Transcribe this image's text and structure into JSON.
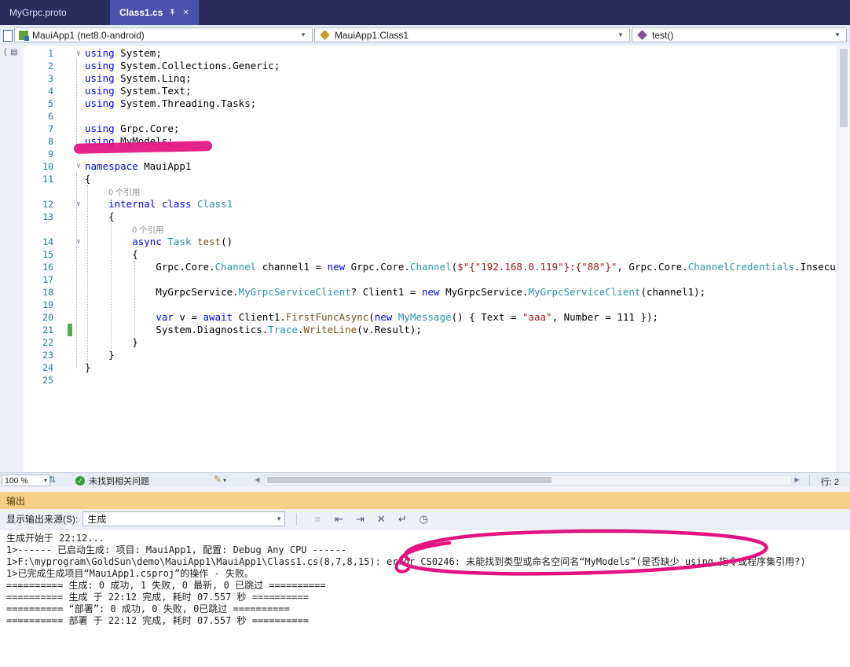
{
  "tabs": [
    {
      "label": "MyGrpc.proto",
      "active": false
    },
    {
      "label": "Class1.cs",
      "active": true
    }
  ],
  "navbar": {
    "project": "MauiApp1 (net8.0-android)",
    "type_name": "MauiApp1.Class1",
    "member": "test()"
  },
  "editor": {
    "rows": [
      {
        "num": "1",
        "fold": true,
        "segs": [
          [
            "k",
            "using"
          ],
          [
            "d",
            " System;"
          ]
        ]
      },
      {
        "num": "2",
        "segs": [
          [
            "k",
            "using"
          ],
          [
            "d",
            " System.Collections.Generic;"
          ]
        ]
      },
      {
        "num": "3",
        "segs": [
          [
            "k",
            "using"
          ],
          [
            "d",
            " System.Linq;"
          ]
        ]
      },
      {
        "num": "4",
        "segs": [
          [
            "k",
            "using"
          ],
          [
            "d",
            " System.Text;"
          ]
        ]
      },
      {
        "num": "5",
        "segs": [
          [
            "k",
            "using"
          ],
          [
            "d",
            " System.Threading.Tasks;"
          ]
        ]
      },
      {
        "num": "6",
        "segs": []
      },
      {
        "num": "7",
        "segs": [
          [
            "k",
            "using"
          ],
          [
            "d",
            " Grpc.Core;"
          ]
        ]
      },
      {
        "num": "8",
        "segs": [
          [
            "k",
            "using"
          ],
          [
            "d",
            " MyModels;"
          ]
        ]
      },
      {
        "num": "9",
        "segs": []
      },
      {
        "num": "10",
        "fold": true,
        "segs": [
          [
            "k",
            "namespace"
          ],
          [
            "d",
            " MauiApp1"
          ]
        ]
      },
      {
        "num": "11",
        "segs": [
          [
            "d",
            "{"
          ]
        ]
      },
      {
        "segs": [
          [
            "d",
            "    "
          ],
          [
            "g",
            "0 个引用"
          ]
        ]
      },
      {
        "num": "12",
        "fold": true,
        "segs": [
          [
            "d",
            "    "
          ],
          [
            "k",
            "internal"
          ],
          [
            "d",
            " "
          ],
          [
            "k",
            "class"
          ],
          [
            "d",
            " "
          ],
          [
            "t",
            "Class1"
          ]
        ]
      },
      {
        "num": "13",
        "segs": [
          [
            "d",
            "    {"
          ]
        ]
      },
      {
        "segs": [
          [
            "d",
            "        "
          ],
          [
            "g",
            "0 个引用"
          ]
        ]
      },
      {
        "num": "14",
        "fold": true,
        "segs": [
          [
            "d",
            "        "
          ],
          [
            "k",
            "async"
          ],
          [
            "d",
            " "
          ],
          [
            "t",
            "Task"
          ],
          [
            "d",
            " "
          ],
          [
            "m",
            "test"
          ],
          [
            "d",
            "()"
          ]
        ]
      },
      {
        "num": "15",
        "segs": [
          [
            "d",
            "        {"
          ]
        ]
      },
      {
        "num": "16",
        "segs": [
          [
            "d",
            "            Grpc.Core."
          ],
          [
            "t",
            "Channel"
          ],
          [
            "d",
            " channel1 = "
          ],
          [
            "k",
            "new"
          ],
          [
            "d",
            " Grpc.Core."
          ],
          [
            "t",
            "Channel"
          ],
          [
            "d",
            "("
          ],
          [
            "s",
            "$\"{\"192.168.0.119\"}:{\"88\"}\""
          ],
          [
            "d",
            ", Grpc.Core."
          ],
          [
            "t",
            "ChannelCredentials"
          ],
          [
            "d",
            ".Insecure);"
          ]
        ]
      },
      {
        "num": "17",
        "segs": []
      },
      {
        "num": "18",
        "segs": [
          [
            "d",
            "            MyGrpcService."
          ],
          [
            "t",
            "MyGrpcServiceClient"
          ],
          [
            "d",
            "? Client1 = "
          ],
          [
            "k",
            "new"
          ],
          [
            "d",
            " MyGrpcService."
          ],
          [
            "t",
            "MyGrpcServiceClient"
          ],
          [
            "d",
            "(channel1);"
          ]
        ]
      },
      {
        "num": "19",
        "segs": []
      },
      {
        "num": "20",
        "segs": [
          [
            "d",
            "            "
          ],
          [
            "k",
            "var"
          ],
          [
            "d",
            " v = "
          ],
          [
            "k",
            "await"
          ],
          [
            "d",
            " Client1."
          ],
          [
            "m",
            "FirstFuncAsync"
          ],
          [
            "d",
            "("
          ],
          [
            "k",
            "new"
          ],
          [
            "d",
            " "
          ],
          [
            "t",
            "MyMessage"
          ],
          [
            "d",
            "() { Text = "
          ],
          [
            "s",
            "\"aaa\""
          ],
          [
            "d",
            ", Number = 111 });"
          ]
        ]
      },
      {
        "num": "21",
        "chg": true,
        "segs": [
          [
            "d",
            "            System.Diagnostics."
          ],
          [
            "t",
            "Trace"
          ],
          [
            "d",
            "."
          ],
          [
            "m",
            "WriteLine"
          ],
          [
            "d",
            "(v.Result);"
          ]
        ]
      },
      {
        "num": "22",
        "segs": [
          [
            "d",
            "        }"
          ]
        ]
      },
      {
        "num": "23",
        "segs": [
          [
            "d",
            "    }"
          ]
        ]
      },
      {
        "num": "24",
        "segs": [
          [
            "d",
            "}"
          ]
        ]
      },
      {
        "num": "25",
        "segs": []
      }
    ]
  },
  "statusbar": {
    "zoom": "100 %",
    "health": "未找到相关问题",
    "line_info": "行: 2"
  },
  "output": {
    "title": "输出",
    "source_label": "显示输出来源(S):",
    "source_value": "生成",
    "lines": [
      "生成开始于 22:12...",
      "1>------ 已启动生成: 项目: MauiApp1, 配置: Debug Any CPU ------",
      "1>F:\\myprogram\\GoldSun\\demo\\MauiApp1\\MauiApp1\\Class1.cs(8,7,8,15): error CS0246: 未能找到类型或命名空间名“MyModels”(是否缺少 using 指令或程序集引用?)",
      "1>已完成生成项目“MauiApp1.csproj”的操作 - 失败。",
      "========== 生成: 0 成功, 1 失败, 0 最新, 0 已跳过 ==========",
      "========== 生成 于 22:12 完成, 耗时 07.557 秒 ==========",
      "========== “部署”: 0 成功, 0 失败, 0已跳过 ==========",
      "========== 部署 于 22:12 完成, 耗时 07.557 秒 =========="
    ]
  },
  "icons": {
    "close": "✕",
    "chevron_down": "▾",
    "fold_open": "∨",
    "health_check": "✓",
    "scroll_left": "◀",
    "scroll_right": "▶",
    "cleanup": "✎",
    "sync": "⇅",
    "outline": "{ ▤",
    "toolbar": [
      "≡",
      "⇤",
      "⇥",
      "✕",
      "↵",
      "◷"
    ]
  },
  "colors": {
    "annotation_magenta": "#E3127F",
    "keyword": "#0000FF",
    "type": "#2B91AF",
    "string": "#A31515",
    "method": "#74531F",
    "line_number": "#237893",
    "tab_active_bg": "#4A52AC",
    "tabstrip_bg": "#2C2C5E",
    "output_header_bg": "#F6CE85",
    "change_bar_green": "#55A854",
    "health_green": "#3C9B35"
  }
}
